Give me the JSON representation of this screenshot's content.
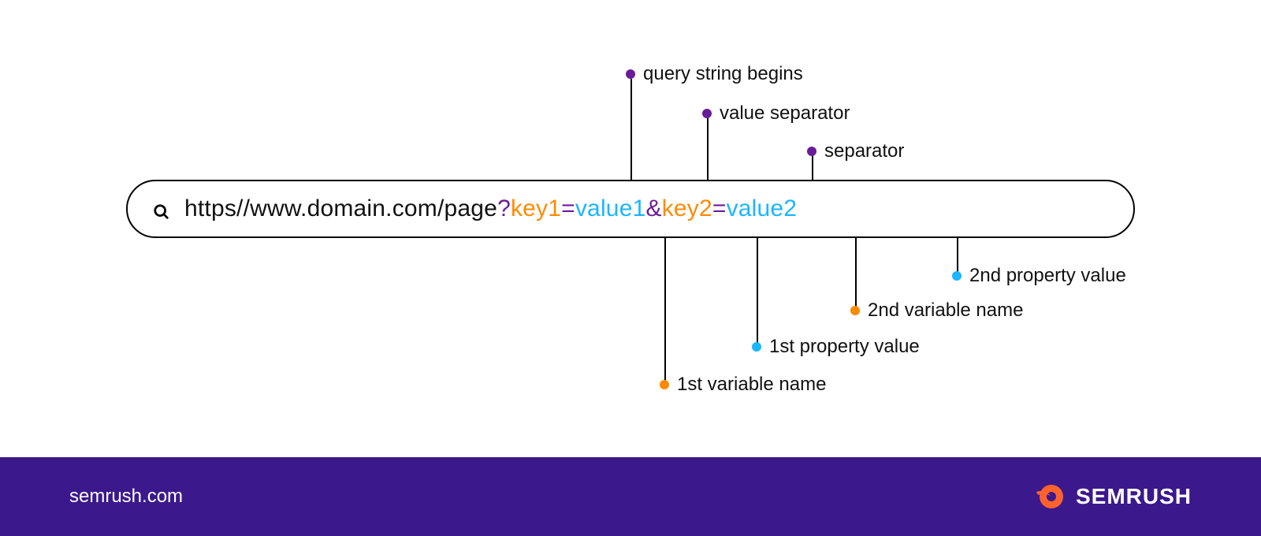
{
  "url": {
    "base": "https//www.domain.com/page",
    "qmark": "?",
    "key1": "key1",
    "eq1": "=",
    "val1": "value1",
    "amp": "&",
    "key2": "key2",
    "eq2": "=",
    "val2": "value2"
  },
  "callouts": {
    "top": {
      "qbegins": "query string begins",
      "valuesep": "value separator",
      "separator": "separator"
    },
    "bottom": {
      "var1": "1st variable name",
      "prop1": "1st property value",
      "var2": "2nd variable name",
      "prop2": "2nd property value"
    }
  },
  "footer": {
    "site": "semrush.com",
    "brand": "SEMRUSH"
  },
  "colors": {
    "purple": "#6A1B9A",
    "orange": "#FF8A00",
    "blue": "#1AB6FF",
    "footer_bg": "#3B198C",
    "brand_orange": "#FF622D"
  }
}
